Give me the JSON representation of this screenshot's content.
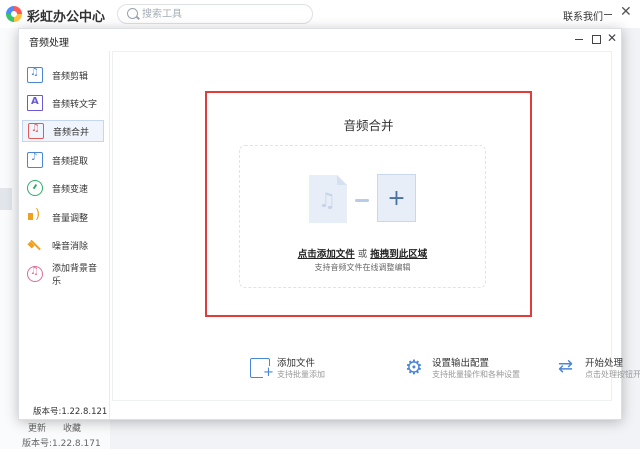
{
  "app": {
    "title": "彩虹办公中心",
    "contact": "联系我们"
  },
  "search": {
    "placeholder": "搜索工具"
  },
  "background": {
    "update": "更新",
    "collect": "收藏",
    "version": "版本号:1.22.8.171"
  },
  "modal": {
    "title": "音频处理",
    "version": "版本号:1.22.8.121"
  },
  "sidebar": {
    "items": [
      {
        "label": "音频剪辑",
        "icon": "audio-cut-icon"
      },
      {
        "label": "音频转文字",
        "icon": "audio-to-text-icon"
      },
      {
        "label": "音频合并",
        "icon": "audio-merge-icon",
        "active": true
      },
      {
        "label": "音频提取",
        "icon": "audio-extract-icon"
      },
      {
        "label": "音频变速",
        "icon": "audio-speed-icon"
      },
      {
        "label": "音量调整",
        "icon": "volume-icon"
      },
      {
        "label": "噪音消除",
        "icon": "noise-removal-icon"
      },
      {
        "label": "添加背景音乐",
        "icon": "background-music-icon"
      }
    ]
  },
  "merge": {
    "title": "音频合并",
    "drop_click": "点击添加文件",
    "drop_or": "或",
    "drop_drag": "拖拽到此区域",
    "drop_sub": "支持音频文件在线调整编辑",
    "plus": "+"
  },
  "actions": {
    "add": {
      "title": "添加文件",
      "sub": "支持批量添加"
    },
    "settings": {
      "title": "设置输出配置",
      "sub": "支持批量操作和各种设置"
    },
    "start": {
      "title": "开始处理",
      "sub": "点击处理按钮开始处理"
    }
  },
  "colors": {
    "accent": "#4a86d8",
    "highlight_border": "#e03c3c",
    "active_bg": "#f0f5fd"
  }
}
